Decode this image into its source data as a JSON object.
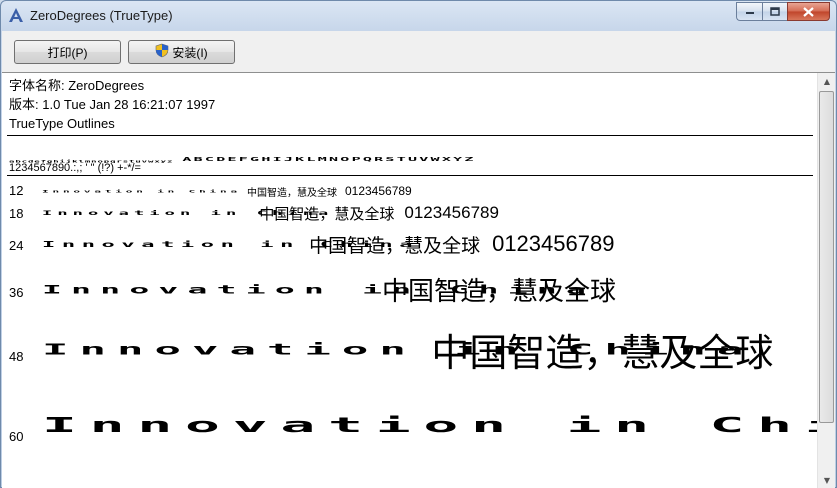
{
  "window": {
    "title": "ZeroDegrees (TrueType)"
  },
  "toolbar": {
    "print_label": "打印(P)",
    "install_label": "安装(I)"
  },
  "font_info": {
    "name_line": "字体名称: ZeroDegrees",
    "version_line": "版本: 1.0 Tue Jan 28 16:21:07 1997",
    "format_line": "TrueType Outlines"
  },
  "charset": {
    "lower": "abcdefghijklmnopqrstuvwxyz",
    "upper": "ABCDEFGHIJKLMNOPQRSTUVWXYZ",
    "numbers": "1234567890.:,; ' \" (!?) +-*/="
  },
  "sample": {
    "latin": "Innovation in China",
    "cjk": "中国智造，慧及全球",
    "digits": "0123456789"
  },
  "sizes": [
    {
      "label": "12"
    },
    {
      "label": "18"
    },
    {
      "label": "24"
    },
    {
      "label": "36"
    },
    {
      "label": "48"
    },
    {
      "label": "60"
    }
  ]
}
